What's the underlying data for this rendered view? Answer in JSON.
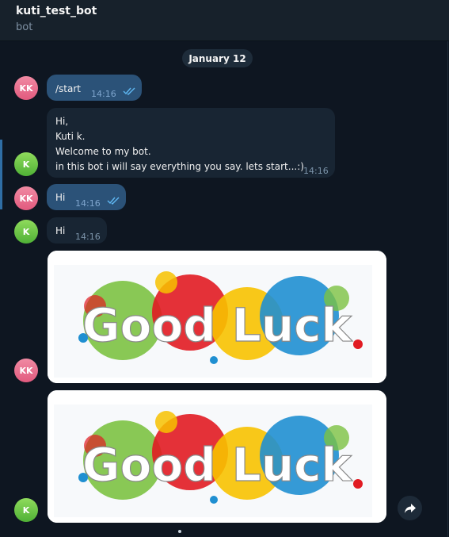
{
  "header": {
    "title": "kuti_test_bot",
    "subtitle": "bot"
  },
  "date_label": "January 12",
  "avatars": {
    "user_initials": "KK",
    "bot_initials": "K"
  },
  "messages": [
    {
      "from": "user",
      "text": "/start",
      "time": "14:16"
    },
    {
      "from": "bot",
      "lines": [
        "Hi,",
        "Kuti k.",
        "Welcome to my bot.",
        "in this bot i will say everything you say. lets start...:)"
      ],
      "time": "14:16"
    },
    {
      "from": "user",
      "text": "Hi",
      "time": "14:16"
    },
    {
      "from": "bot",
      "text": "Hi",
      "time": "14:16"
    }
  ],
  "photos": [
    {
      "from": "user",
      "image_text": "Good Luck"
    },
    {
      "from": "bot",
      "image_text": "Good Luck"
    }
  ],
  "colors": {
    "background": "#0e1621",
    "header": "#17212b",
    "outgoing_bubble": "#2b5278",
    "incoming_bubble": "#182533",
    "avatar_user": "#e8698a",
    "avatar_bot": "#6cc847",
    "check_marks": "#5fb8f3"
  },
  "icons": {
    "read_status": "double-check-icon",
    "forward": "share-arrow-icon"
  }
}
